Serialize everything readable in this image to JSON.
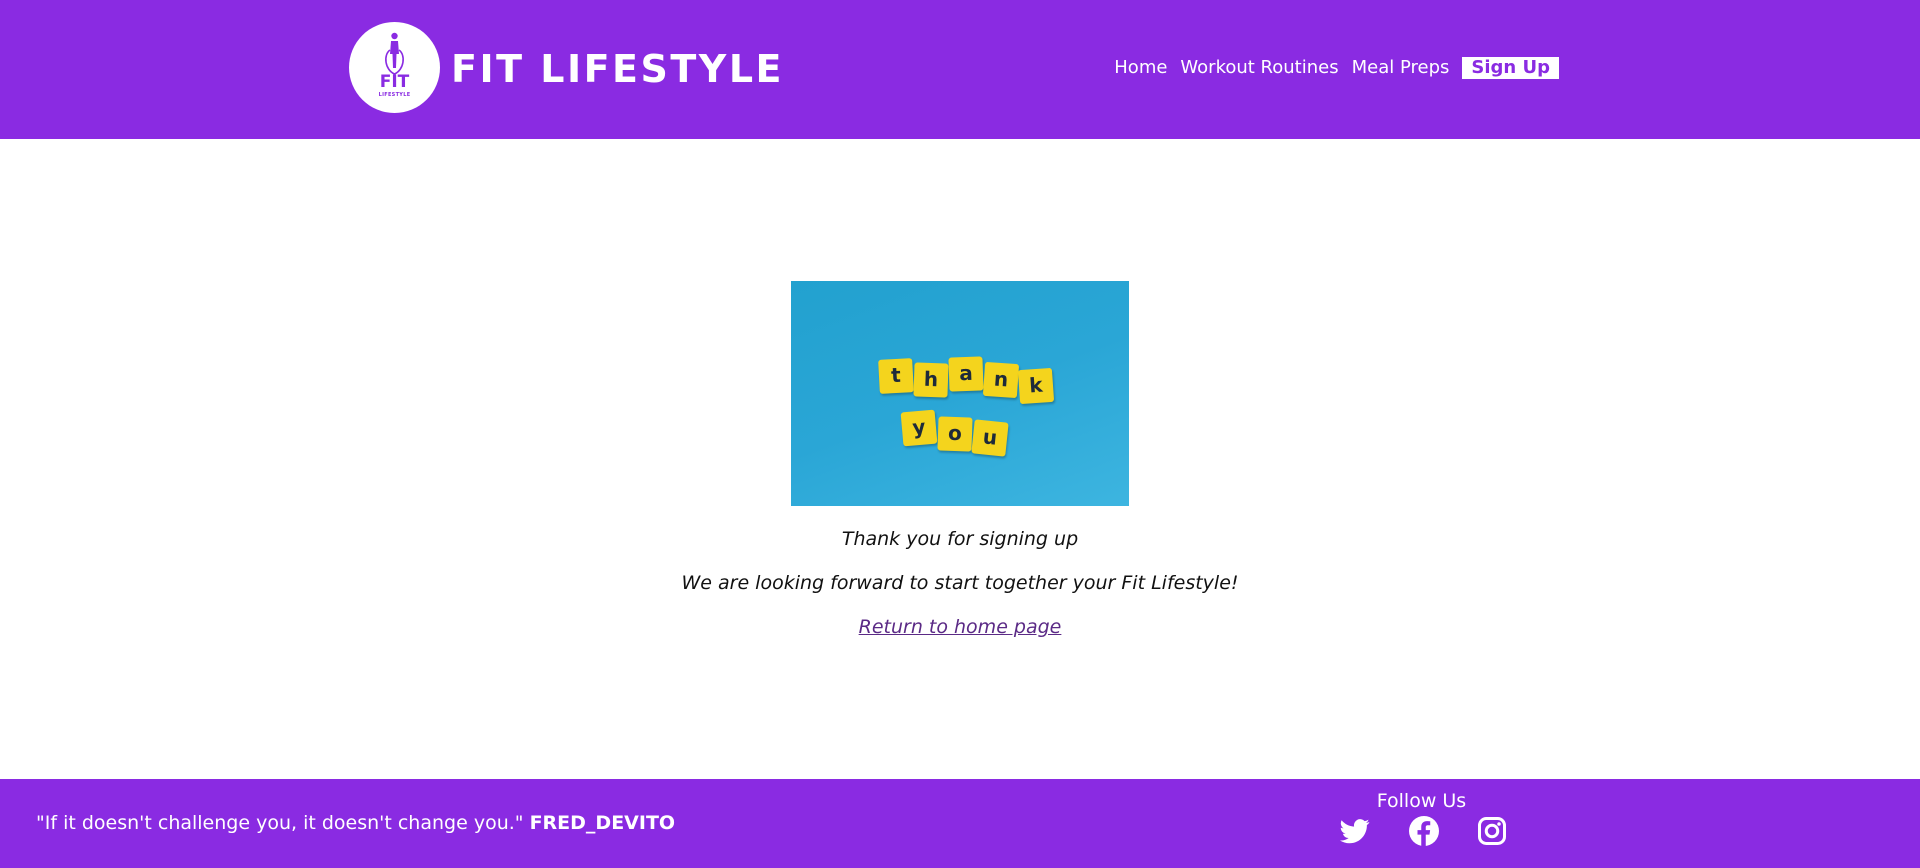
{
  "header": {
    "logo_text": "FIT",
    "logo_subtext": "LIFESTYLE",
    "brand": "FIT LIFESTYLE",
    "nav": {
      "home": "Home",
      "workouts": "Workout Routines",
      "meals": "Meal Preps",
      "signup": "Sign Up"
    }
  },
  "hero_image": {
    "tiles_line1": [
      "t",
      "h",
      "a",
      "n",
      "k"
    ],
    "tiles_line2": [
      "y",
      "o",
      "u"
    ]
  },
  "main": {
    "thanks": "Thank you for signing up",
    "forward": "We are looking forward to start together your Fit Lifestyle!",
    "return_link": "Return to home page"
  },
  "footer": {
    "quote": "\"If it doesn't challenge you, it doesn't change you.\"",
    "quote_author": "FRED_DEVITO",
    "follow_label": "Follow Us",
    "social_icons": [
      "twitter-icon",
      "facebook-icon",
      "instagram-icon"
    ]
  },
  "colors": {
    "brand_purple": "#8a2be2",
    "link_purple": "#5b2a86",
    "image_blue": "#2aa6d6",
    "tile_yellow": "#f4d41d"
  }
}
